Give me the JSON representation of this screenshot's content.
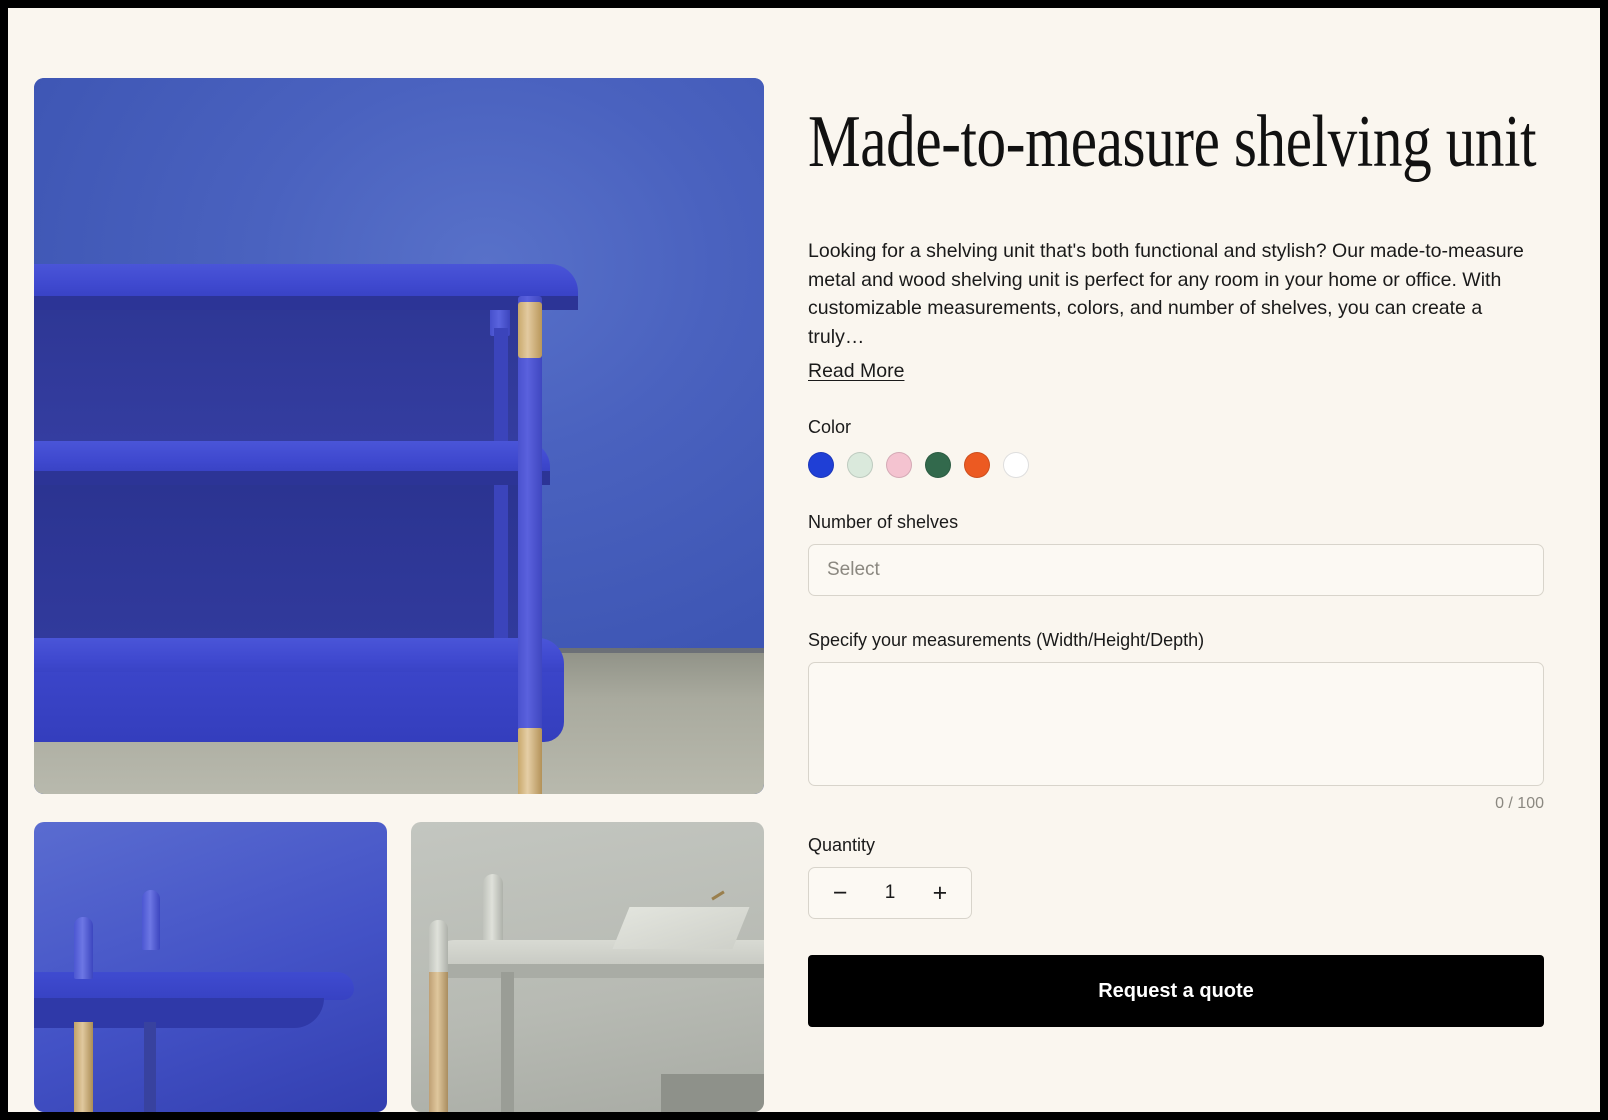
{
  "product": {
    "title": "Made-to-measure shelving unit",
    "description": "Looking for a shelving unit that's both functional and stylish? Our made-to-measure metal and wood shelving unit is perfect for any room in your home or office. With customizable measurements, colors, and number of shelves, you can create a truly…",
    "read_more_label": "Read More"
  },
  "color": {
    "label": "Color",
    "options": [
      {
        "name": "blue",
        "hex": "#1f3fd6"
      },
      {
        "name": "mint",
        "hex": "#dae9dc"
      },
      {
        "name": "pink",
        "hex": "#f4c3d0"
      },
      {
        "name": "forest-green",
        "hex": "#32694c"
      },
      {
        "name": "orange",
        "hex": "#ec5a22"
      },
      {
        "name": "white",
        "hex": "#ffffff"
      }
    ]
  },
  "shelves": {
    "label": "Number of shelves",
    "placeholder": "Select",
    "value": ""
  },
  "measurements": {
    "label": "Specify your measurements (Width/Height/Depth)",
    "value": "",
    "counter": "0 / 100"
  },
  "quantity": {
    "label": "Quantity",
    "value": "1",
    "decrement_icon": "−",
    "increment_icon": "+"
  },
  "cta": {
    "label": "Request a quote"
  },
  "gallery": {
    "hero_alt": "blue metal and wood shelving unit against blue wall",
    "thumbs": [
      {
        "alt": "close-up of blue shelf with wood post"
      },
      {
        "alt": "grey shelf with tray on top"
      }
    ]
  }
}
